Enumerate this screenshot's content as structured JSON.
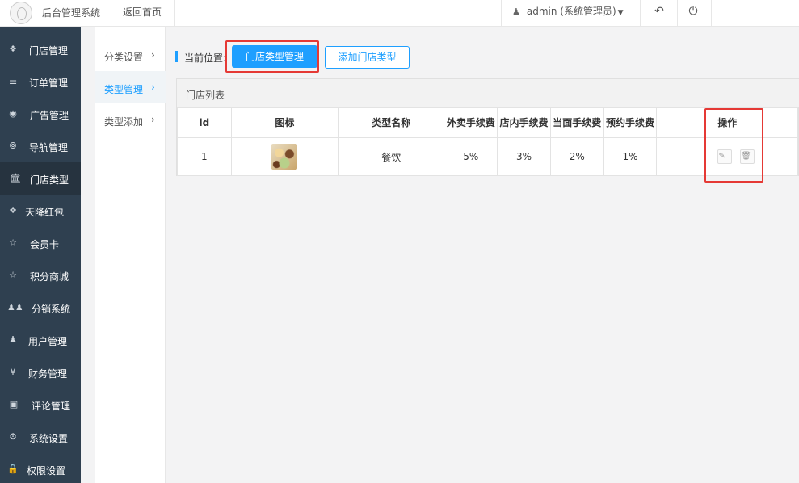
{
  "topbar": {
    "app_title": "后台管理系统",
    "back_home": "返回首页",
    "user": "admin (系统管理员)",
    "user_icon": "user-icon",
    "back_icon": "undo-icon",
    "power_icon": "power-icon"
  },
  "sidebar": {
    "items": [
      {
        "label": "门店管理",
        "icon": "cubes-icon"
      },
      {
        "label": "订单管理",
        "icon": "list-icon"
      },
      {
        "label": "广告管理",
        "icon": "lifebuoy-icon"
      },
      {
        "label": "导航管理",
        "icon": "compass-icon"
      },
      {
        "label": "门店类型",
        "icon": "bank-icon",
        "active": true
      },
      {
        "label": "天降红包",
        "icon": "cubes-icon"
      },
      {
        "label": "会员卡",
        "icon": "star-icon"
      },
      {
        "label": "积分商城",
        "icon": "star-icon"
      },
      {
        "label": "分销系统",
        "icon": "users-icon"
      },
      {
        "label": "用户管理",
        "icon": "user-icon"
      },
      {
        "label": "财务管理",
        "icon": "yen-icon"
      },
      {
        "label": "评论管理",
        "icon": "money-icon"
      },
      {
        "label": "系统设置",
        "icon": "gear-icon"
      },
      {
        "label": "权限设置",
        "icon": "lock-icon"
      }
    ]
  },
  "subnav": {
    "items": [
      {
        "label": "分类设置"
      },
      {
        "label": "类型管理",
        "active": true
      },
      {
        "label": "类型添加"
      }
    ]
  },
  "main": {
    "crumb_label": "当前位置:",
    "primary_button": "门店类型管理",
    "secondary_button": "添加门店类型",
    "panel_title": "门店列表",
    "table": {
      "headers": [
        "id",
        "图标",
        "类型名称",
        "外卖手续费",
        "店内手续费",
        "当面手续费",
        "预约手续费",
        "操作"
      ],
      "rows": [
        {
          "id": "1",
          "name": "餐饮",
          "takeout_fee": "5%",
          "instore_fee": "3%",
          "facetoface_fee": "2%",
          "reservation_fee": "1%"
        }
      ]
    }
  },
  "colors": {
    "accent": "#1e9fff",
    "sidebar_bg": "#2f4050",
    "highlight": "#e53935"
  }
}
